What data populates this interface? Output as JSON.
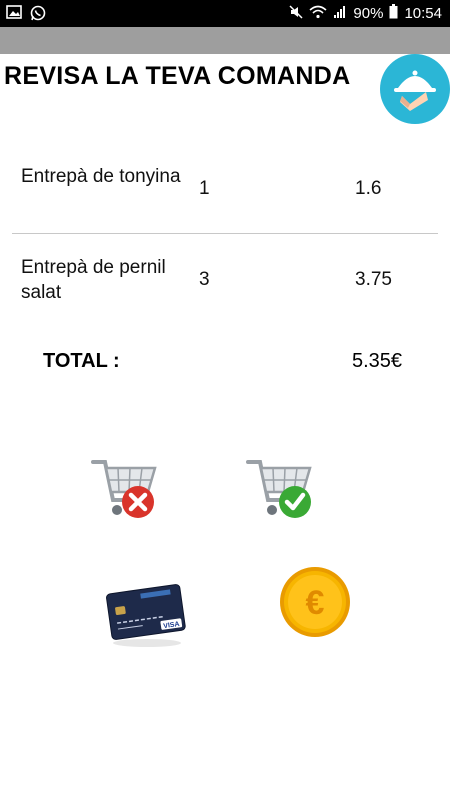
{
  "status_bar": {
    "battery": "90%",
    "time": "10:54",
    "icons": [
      "image-icon",
      "whatsapp-icon",
      "mute-icon",
      "wifi-icon",
      "signal-icon",
      "battery-icon"
    ]
  },
  "header": {
    "title": "REVISA LA TEVA COMANDA",
    "waiter_icon": "waiter-icon"
  },
  "order": {
    "items": [
      {
        "name": "Entrepà de tonyina",
        "qty": "1",
        "price": "1.6"
      },
      {
        "name": "Entrepà de pernil salat",
        "qty": "3",
        "price": "3.75"
      }
    ],
    "total_label": "TOTAL  :",
    "total_value": "5.35€"
  },
  "actions": {
    "cancel_cart": "cart-cancel-icon",
    "confirm_cart": "cart-confirm-icon",
    "card_payment": "credit-card-icon",
    "cash_payment": "euro-coin-icon",
    "card_text": "VISA",
    "coin_symbol": "€"
  },
  "colors": {
    "accent": "#2bb6d6",
    "header_bar": "#9e9e9e",
    "cancel": "#d9342b",
    "confirm": "#3aa935",
    "coin": "#f5a800"
  }
}
